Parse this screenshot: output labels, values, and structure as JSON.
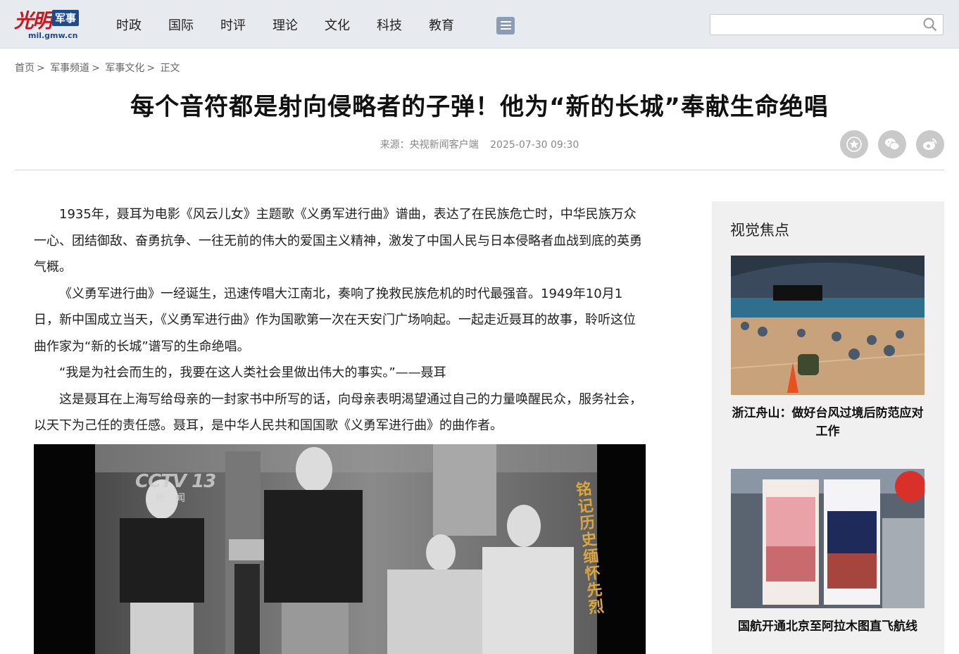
{
  "header": {
    "logo_text": "光明",
    "logo_tag": "军事",
    "logo_url": "mil.gmw.cn",
    "nav": [
      "时政",
      "国际",
      "时评",
      "理论",
      "文化",
      "科技",
      "教育"
    ],
    "search_placeholder": ""
  },
  "breadcrumb": [
    {
      "label": "首页",
      "sep": ">"
    },
    {
      "label": "军事频道",
      "sep": ">"
    },
    {
      "label": "军事文化",
      "sep": ">"
    },
    {
      "label": "正文",
      "sep": ""
    }
  ],
  "article": {
    "title": "每个音符都是射向侵略者的子弹！他为“新的长城”奉献生命绝唱",
    "source": "来源：央视新闻客户端",
    "date": "2025-07-30 09:30",
    "paragraphs": [
      "1935年，聂耳为电影《风云儿女》主题歌《义勇军进行曲》谱曲，表达了在民族危亡时，中华民族万众一心、团结御敌、奋勇抗争、一往无前的伟大的爱国主义精神，激发了中国人民与日本侵略者血战到底的英勇气概。",
      "《义勇军进行曲》一经诞生，迅速传唱大江南北，奏响了挽救民族危机的时代最强音。1949年10月1日，新中国成立当天，《义勇军进行曲》作为国歌第一次在天安门广场响起。一起走近聂耳的故事，聆听这位曲作家为“新的长城”谱写的生命绝唱。",
      "“我是为社会而生的，我要在这人类社会里做出伟大的事实。”——聂耳",
      "这是聂耳在上海写给母亲的一封家书中所写的话，向母亲表明渴望通过自己的力量唤醒民众，服务社会，以天下为己任的责任感。聂耳，是中华人民共和国国歌《义勇军进行曲》的曲作者。"
    ],
    "photo_watermark": "CCTV 13",
    "photo_watermark_sub": "新闻",
    "photo_caption_line1": "铭记历史",
    "photo_caption_line2": "缅怀先烈"
  },
  "sidebar": {
    "title": "视觉焦点",
    "items": [
      {
        "caption": "浙江舟山：做好台风过境后防范应对工作"
      },
      {
        "caption": "国航开通北京至阿拉木图直飞航线"
      }
    ]
  },
  "share_icons": [
    "favorite-star-icon",
    "wechat-icon",
    "weibo-icon"
  ],
  "colors": {
    "brand_red": "#c8161d",
    "brand_blue": "#1f4a8a",
    "topbar": "#e7ebef"
  }
}
